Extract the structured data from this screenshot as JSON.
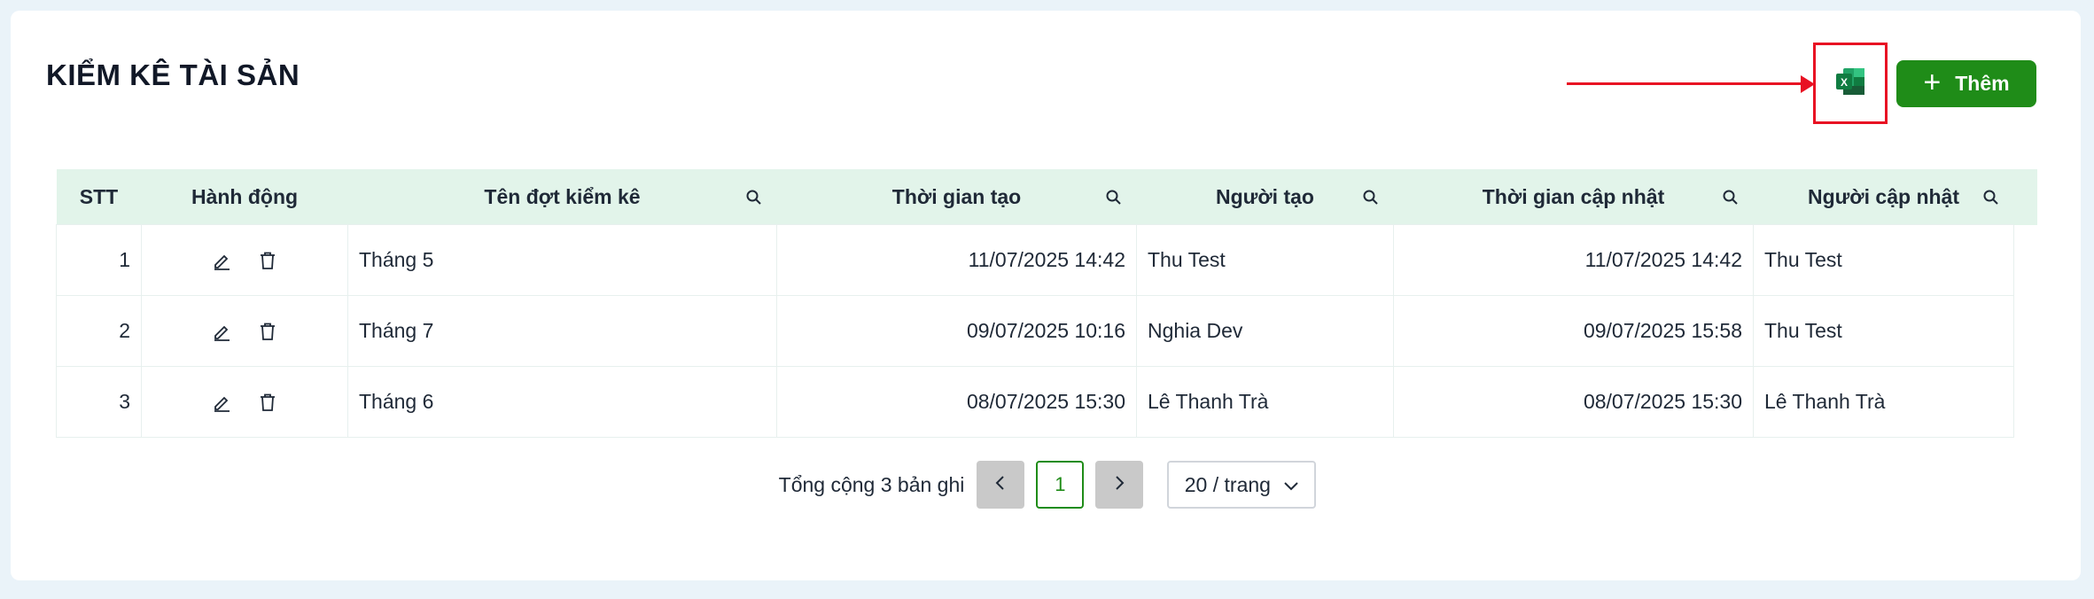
{
  "page": {
    "title": "KIỂM KÊ TÀI SẢN"
  },
  "toolbar": {
    "export_icon": "excel-icon",
    "add_label": "Thêm",
    "add_icon": "plus-icon",
    "accent_color": "#1f8c18",
    "highlight_color": "#e81123"
  },
  "table": {
    "columns": [
      {
        "label": "STT",
        "searchable": false
      },
      {
        "label": "Hành động",
        "searchable": false
      },
      {
        "label": "Tên đợt kiểm kê",
        "searchable": true
      },
      {
        "label": "Thời gian tạo",
        "searchable": true
      },
      {
        "label": "Người tạo",
        "searchable": true
      },
      {
        "label": "Thời gian cập nhật",
        "searchable": true
      },
      {
        "label": "Người cập nhật",
        "searchable": true
      }
    ],
    "rows": [
      {
        "stt": "1",
        "name": "Tháng 5",
        "created_at": "11/07/2025 14:42",
        "created_by": "Thu Test",
        "updated_at": "11/07/2025 14:42",
        "updated_by": "Thu Test"
      },
      {
        "stt": "2",
        "name": "Tháng 7",
        "created_at": "09/07/2025 10:16",
        "created_by": "Nghia Dev",
        "updated_at": "09/07/2025 15:58",
        "updated_by": "Thu Test"
      },
      {
        "stt": "3",
        "name": "Tháng 6",
        "created_at": "08/07/2025 15:30",
        "created_by": "Lê Thanh Trà",
        "updated_at": "08/07/2025 15:30",
        "updated_by": "Lê Thanh Trà"
      }
    ],
    "row_actions": [
      "edit-icon",
      "trash-icon"
    ]
  },
  "pagination": {
    "total_text": "Tổng cộng 3 bản ghi",
    "current_page": "1",
    "page_size": "20 / trang"
  }
}
